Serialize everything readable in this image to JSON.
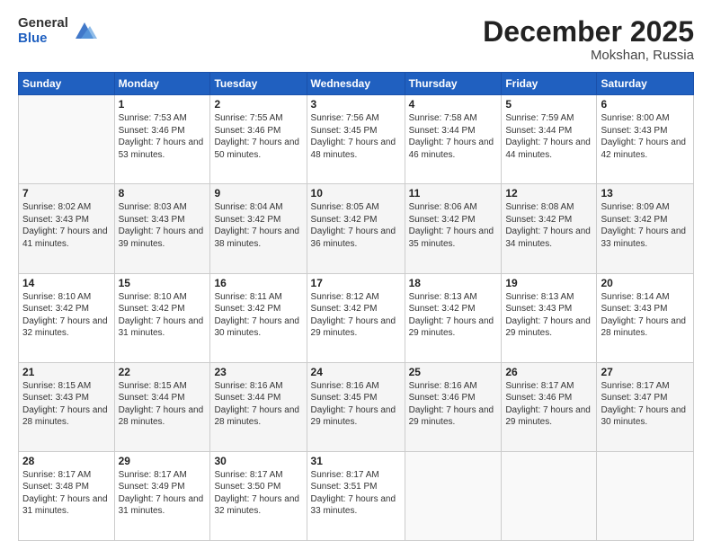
{
  "header": {
    "logo_general": "General",
    "logo_blue": "Blue",
    "month_title": "December 2025",
    "location": "Mokshan, Russia"
  },
  "weekdays": [
    "Sunday",
    "Monday",
    "Tuesday",
    "Wednesday",
    "Thursday",
    "Friday",
    "Saturday"
  ],
  "weeks": [
    [
      {
        "day": "",
        "sunrise": "",
        "sunset": "",
        "daylight": ""
      },
      {
        "day": "1",
        "sunrise": "Sunrise: 7:53 AM",
        "sunset": "Sunset: 3:46 PM",
        "daylight": "Daylight: 7 hours and 53 minutes."
      },
      {
        "day": "2",
        "sunrise": "Sunrise: 7:55 AM",
        "sunset": "Sunset: 3:46 PM",
        "daylight": "Daylight: 7 hours and 50 minutes."
      },
      {
        "day": "3",
        "sunrise": "Sunrise: 7:56 AM",
        "sunset": "Sunset: 3:45 PM",
        "daylight": "Daylight: 7 hours and 48 minutes."
      },
      {
        "day": "4",
        "sunrise": "Sunrise: 7:58 AM",
        "sunset": "Sunset: 3:44 PM",
        "daylight": "Daylight: 7 hours and 46 minutes."
      },
      {
        "day": "5",
        "sunrise": "Sunrise: 7:59 AM",
        "sunset": "Sunset: 3:44 PM",
        "daylight": "Daylight: 7 hours and 44 minutes."
      },
      {
        "day": "6",
        "sunrise": "Sunrise: 8:00 AM",
        "sunset": "Sunset: 3:43 PM",
        "daylight": "Daylight: 7 hours and 42 minutes."
      }
    ],
    [
      {
        "day": "7",
        "sunrise": "Sunrise: 8:02 AM",
        "sunset": "Sunset: 3:43 PM",
        "daylight": "Daylight: 7 hours and 41 minutes."
      },
      {
        "day": "8",
        "sunrise": "Sunrise: 8:03 AM",
        "sunset": "Sunset: 3:43 PM",
        "daylight": "Daylight: 7 hours and 39 minutes."
      },
      {
        "day": "9",
        "sunrise": "Sunrise: 8:04 AM",
        "sunset": "Sunset: 3:42 PM",
        "daylight": "Daylight: 7 hours and 38 minutes."
      },
      {
        "day": "10",
        "sunrise": "Sunrise: 8:05 AM",
        "sunset": "Sunset: 3:42 PM",
        "daylight": "Daylight: 7 hours and 36 minutes."
      },
      {
        "day": "11",
        "sunrise": "Sunrise: 8:06 AM",
        "sunset": "Sunset: 3:42 PM",
        "daylight": "Daylight: 7 hours and 35 minutes."
      },
      {
        "day": "12",
        "sunrise": "Sunrise: 8:08 AM",
        "sunset": "Sunset: 3:42 PM",
        "daylight": "Daylight: 7 hours and 34 minutes."
      },
      {
        "day": "13",
        "sunrise": "Sunrise: 8:09 AM",
        "sunset": "Sunset: 3:42 PM",
        "daylight": "Daylight: 7 hours and 33 minutes."
      }
    ],
    [
      {
        "day": "14",
        "sunrise": "Sunrise: 8:10 AM",
        "sunset": "Sunset: 3:42 PM",
        "daylight": "Daylight: 7 hours and 32 minutes."
      },
      {
        "day": "15",
        "sunrise": "Sunrise: 8:10 AM",
        "sunset": "Sunset: 3:42 PM",
        "daylight": "Daylight: 7 hours and 31 minutes."
      },
      {
        "day": "16",
        "sunrise": "Sunrise: 8:11 AM",
        "sunset": "Sunset: 3:42 PM",
        "daylight": "Daylight: 7 hours and 30 minutes."
      },
      {
        "day": "17",
        "sunrise": "Sunrise: 8:12 AM",
        "sunset": "Sunset: 3:42 PM",
        "daylight": "Daylight: 7 hours and 29 minutes."
      },
      {
        "day": "18",
        "sunrise": "Sunrise: 8:13 AM",
        "sunset": "Sunset: 3:42 PM",
        "daylight": "Daylight: 7 hours and 29 minutes."
      },
      {
        "day": "19",
        "sunrise": "Sunrise: 8:13 AM",
        "sunset": "Sunset: 3:43 PM",
        "daylight": "Daylight: 7 hours and 29 minutes."
      },
      {
        "day": "20",
        "sunrise": "Sunrise: 8:14 AM",
        "sunset": "Sunset: 3:43 PM",
        "daylight": "Daylight: 7 hours and 28 minutes."
      }
    ],
    [
      {
        "day": "21",
        "sunrise": "Sunrise: 8:15 AM",
        "sunset": "Sunset: 3:43 PM",
        "daylight": "Daylight: 7 hours and 28 minutes."
      },
      {
        "day": "22",
        "sunrise": "Sunrise: 8:15 AM",
        "sunset": "Sunset: 3:44 PM",
        "daylight": "Daylight: 7 hours and 28 minutes."
      },
      {
        "day": "23",
        "sunrise": "Sunrise: 8:16 AM",
        "sunset": "Sunset: 3:44 PM",
        "daylight": "Daylight: 7 hours and 28 minutes."
      },
      {
        "day": "24",
        "sunrise": "Sunrise: 8:16 AM",
        "sunset": "Sunset: 3:45 PM",
        "daylight": "Daylight: 7 hours and 29 minutes."
      },
      {
        "day": "25",
        "sunrise": "Sunrise: 8:16 AM",
        "sunset": "Sunset: 3:46 PM",
        "daylight": "Daylight: 7 hours and 29 minutes."
      },
      {
        "day": "26",
        "sunrise": "Sunrise: 8:17 AM",
        "sunset": "Sunset: 3:46 PM",
        "daylight": "Daylight: 7 hours and 29 minutes."
      },
      {
        "day": "27",
        "sunrise": "Sunrise: 8:17 AM",
        "sunset": "Sunset: 3:47 PM",
        "daylight": "Daylight: 7 hours and 30 minutes."
      }
    ],
    [
      {
        "day": "28",
        "sunrise": "Sunrise: 8:17 AM",
        "sunset": "Sunset: 3:48 PM",
        "daylight": "Daylight: 7 hours and 31 minutes."
      },
      {
        "day": "29",
        "sunrise": "Sunrise: 8:17 AM",
        "sunset": "Sunset: 3:49 PM",
        "daylight": "Daylight: 7 hours and 31 minutes."
      },
      {
        "day": "30",
        "sunrise": "Sunrise: 8:17 AM",
        "sunset": "Sunset: 3:50 PM",
        "daylight": "Daylight: 7 hours and 32 minutes."
      },
      {
        "day": "31",
        "sunrise": "Sunrise: 8:17 AM",
        "sunset": "Sunset: 3:51 PM",
        "daylight": "Daylight: 7 hours and 33 minutes."
      },
      {
        "day": "",
        "sunrise": "",
        "sunset": "",
        "daylight": ""
      },
      {
        "day": "",
        "sunrise": "",
        "sunset": "",
        "daylight": ""
      },
      {
        "day": "",
        "sunrise": "",
        "sunset": "",
        "daylight": ""
      }
    ]
  ]
}
